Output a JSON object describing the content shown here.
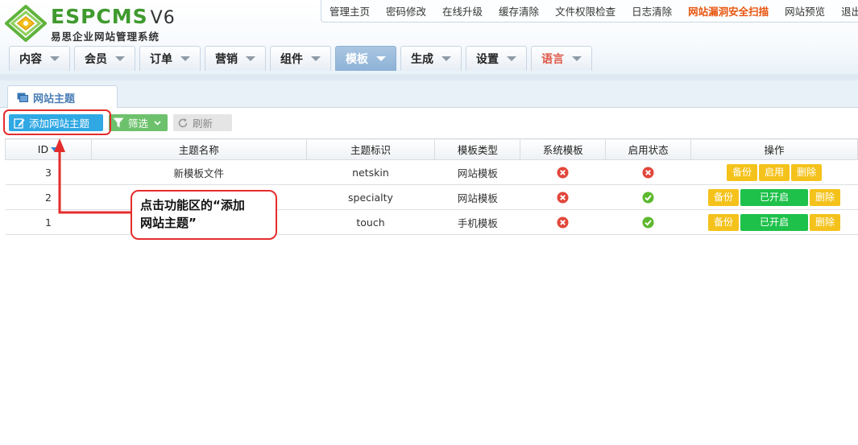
{
  "brand": {
    "logo_text": "ESPCMS",
    "version": "V6",
    "subtitle": "易思企业网站管理系统"
  },
  "topnav": [
    {
      "label": "管理主页"
    },
    {
      "label": "密码修改"
    },
    {
      "label": "在线升级"
    },
    {
      "label": "缓存清除"
    },
    {
      "label": "文件权限检查"
    },
    {
      "label": "日志清除"
    },
    {
      "label": "网站漏洞安全扫描"
    },
    {
      "label": "网站预览"
    },
    {
      "label": "退出"
    }
  ],
  "mainnav": [
    {
      "label": "内容"
    },
    {
      "label": "会员"
    },
    {
      "label": "订单"
    },
    {
      "label": "营销"
    },
    {
      "label": "组件"
    },
    {
      "label": "模板"
    },
    {
      "label": "生成"
    },
    {
      "label": "设置"
    },
    {
      "label": "语言"
    }
  ],
  "active_mainnav": "模板",
  "page_tab": {
    "label": "网站主题"
  },
  "toolbar": {
    "add_label": "添加网站主题",
    "filter_label": "筛选",
    "refresh_label": "刷新"
  },
  "table": {
    "columns": [
      "ID",
      "主题名称",
      "主题标识",
      "模板类型",
      "系统模板",
      "启用状态",
      "操作"
    ],
    "rows": [
      {
        "id": "3",
        "name": "新模板文件",
        "ident": "netskin",
        "type": "网站模板",
        "system": false,
        "enabled": false,
        "actions": [
          "备份",
          "启用",
          "删除"
        ]
      },
      {
        "id": "2",
        "name": "",
        "ident": "specialty",
        "type": "网站模板",
        "system": false,
        "enabled": true,
        "actions": [
          "备份",
          "已开启",
          "删除"
        ]
      },
      {
        "id": "1",
        "name": "",
        "ident": "touch",
        "type": "手机模板",
        "system": false,
        "enabled": true,
        "actions": [
          "备份",
          "已开启",
          "删除"
        ]
      }
    ]
  },
  "annotation": {
    "line1": "点击功能区的“添加",
    "line2": "网站主题”"
  },
  "colors": {
    "accent_blue": "#2fa8e4",
    "filter_green": "#6dc16c",
    "action_yellow": "#f4c21b",
    "action_green": "#1ec14a",
    "annotation_red": "#e52c2c",
    "alert_orange": "#e8560f"
  }
}
